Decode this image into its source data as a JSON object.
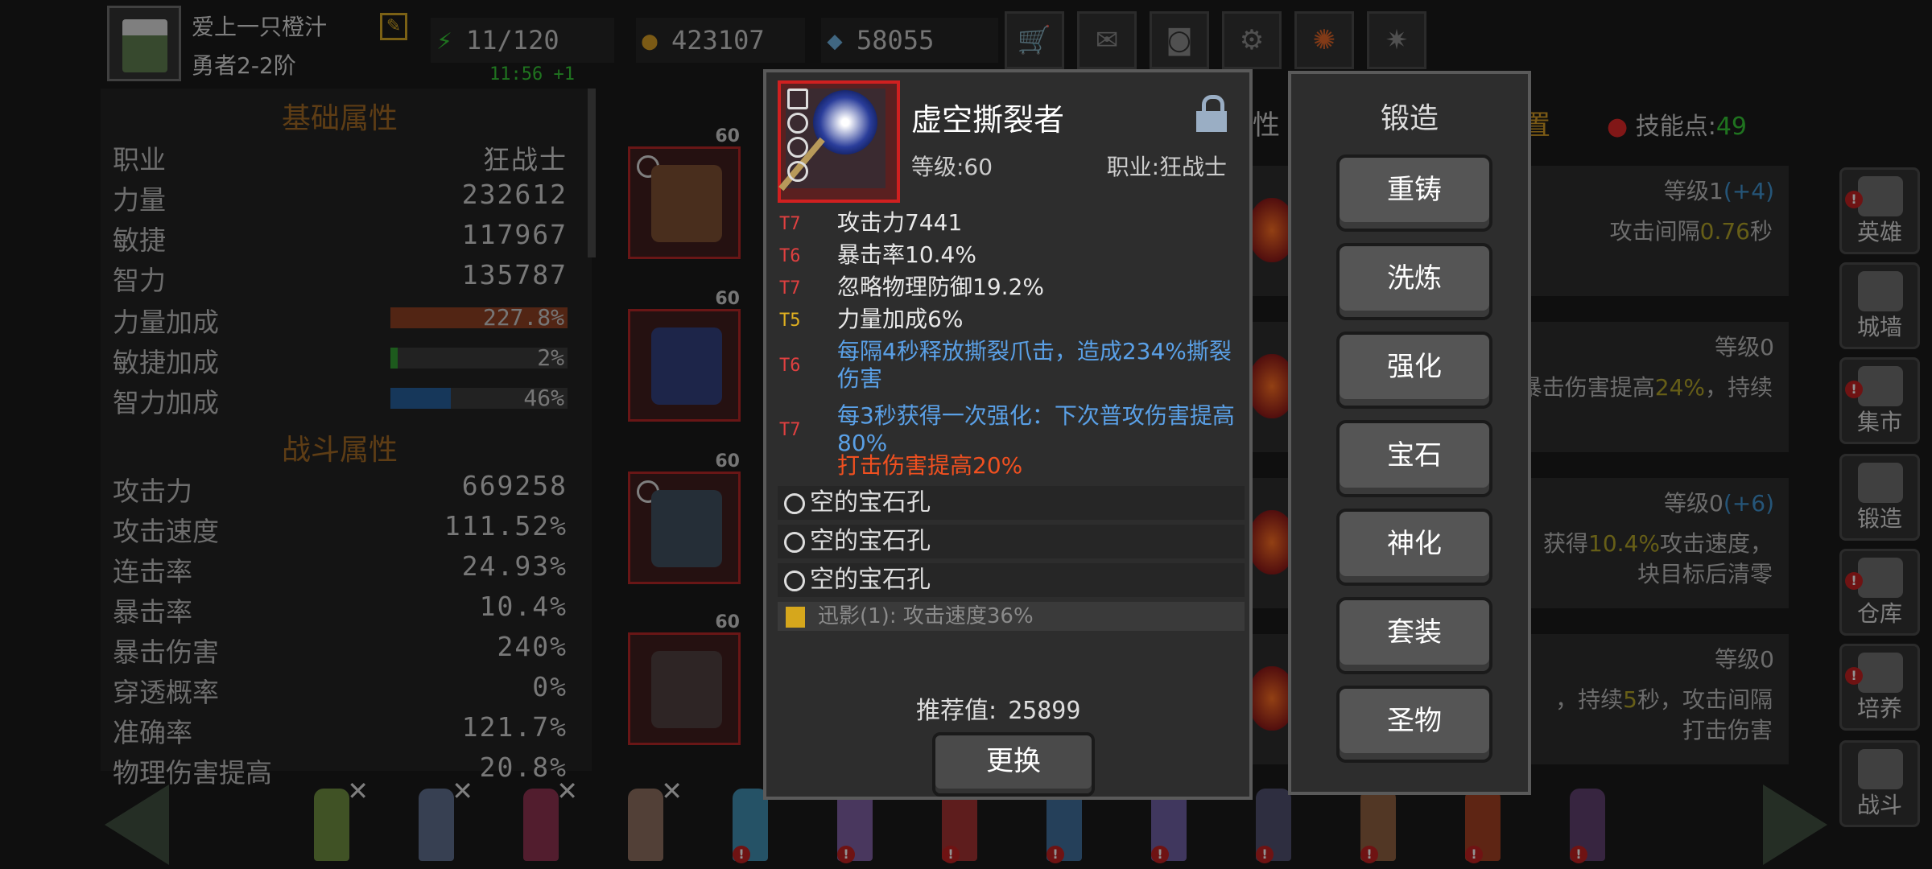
{
  "player": {
    "name": "爱上一只橙汁",
    "rank": "勇者2-2阶"
  },
  "resources": {
    "stamina": "11/120",
    "timer": "11:56 +1",
    "gold": "423107",
    "gems": "58055"
  },
  "top_icons": [
    "cart-icon",
    "mail-icon",
    "gamepad-icon",
    "gear-icon",
    "aperture-icon",
    "sparkle-icon"
  ],
  "left_panel": {
    "basic_title": "基础属性",
    "basic": [
      {
        "label": "职业",
        "value": "狂战士"
      },
      {
        "label": "力量",
        "value": "232612"
      },
      {
        "label": "敏捷",
        "value": "117967"
      },
      {
        "label": "智力",
        "value": "135787"
      }
    ],
    "bonuses": [
      {
        "label": "力量加成",
        "value": "227.8%",
        "fill": 1.0,
        "color": "#8a3a1a"
      },
      {
        "label": "敏捷加成",
        "value": "2%",
        "fill": 0.04,
        "color": "#2a9a2a"
      },
      {
        "label": "智力加成",
        "value": "46%",
        "fill": 0.34,
        "color": "#1e5a9a"
      }
    ],
    "combat_title": "战斗属性",
    "combat": [
      {
        "label": "攻击力",
        "value": "669258"
      },
      {
        "label": "攻击速度",
        "value": "111.52%"
      },
      {
        "label": "连击率",
        "value": "24.93%"
      },
      {
        "label": "暴击率",
        "value": "10.4%"
      },
      {
        "label": "暴击伤害",
        "value": "240%"
      },
      {
        "label": "穿透概率",
        "value": "0%"
      },
      {
        "label": "准确率",
        "value": "121.7%"
      },
      {
        "label": "物理伤害提高",
        "value": "20.8%"
      }
    ]
  },
  "equip_slots": [
    {
      "level": "60"
    },
    {
      "level": "60"
    },
    {
      "level": "60"
    },
    {
      "level": "60"
    }
  ],
  "skills_bg": {
    "tab_partial": "性",
    "reset_partial": "置",
    "skill_points_label": "技能点:",
    "skill_points": "49",
    "cards": [
      {
        "level": "等级1",
        "bonus": "(+4)",
        "desc_pre": "攻击间隔",
        "desc_hl": "0.76",
        "desc_post": "秒"
      },
      {
        "level": "等级0",
        "bonus": "",
        "desc_pre": "暴击伤害提高",
        "desc_hl": "24%",
        "desc_post": "，持续"
      },
      {
        "level": "等级0",
        "bonus": "(+6)",
        "desc_pre": "获得",
        "desc_hl": "10.4%",
        "desc_post": "攻击速度，",
        "desc2": "块目标后清零"
      },
      {
        "level": "等级0",
        "bonus": "",
        "desc_pre": "，持续",
        "desc_hl": "5",
        "desc_post": "秒，攻击间隔",
        "desc2": "打击伤害"
      }
    ]
  },
  "item": {
    "name": "虚空撕裂者",
    "level": "等级:60",
    "class": "职业:狂战士",
    "attrs": [
      {
        "tier": "T7",
        "text": "攻击力7441",
        "tier_color": "#e04040",
        "text_color": "#e8e8e8"
      },
      {
        "tier": "T6",
        "text": "暴击率10.4%",
        "tier_color": "#e04040",
        "text_color": "#e8e8e8"
      },
      {
        "tier": "T7",
        "text": "忽略物理防御19.2%",
        "tier_color": "#e04040",
        "text_color": "#e8e8e8"
      },
      {
        "tier": "T5",
        "text": "力量加成6%",
        "tier_color": "#e0b020",
        "text_color": "#e8e8e8"
      },
      {
        "tier": "T6",
        "text": "每隔4秒释放撕裂爪击，造成234%撕裂伤害",
        "tier_color": "#e04040",
        "text_color": "#5aa0e6"
      },
      {
        "tier": "T7",
        "text": "每3秒获得一次强化：下次普攻伤害提高80%",
        "tier_color": "#e04040",
        "text_color": "#5aa0e6"
      },
      {
        "tier": "",
        "text": "打击伤害提高20%",
        "tier_color": "#e04040",
        "text_color": "#f05020"
      }
    ],
    "gem_slots": [
      "空的宝石孔",
      "空的宝石孔",
      "空的宝石孔"
    ],
    "set_bonus": "迅影(1): 攻击速度36%",
    "recommend_label": "推荐值:",
    "recommend_value": "25899",
    "swap_label": "更换"
  },
  "forge": {
    "title": "锻造",
    "buttons": [
      "重铸",
      "洗炼",
      "强化",
      "宝石",
      "神化",
      "套装",
      "圣物"
    ]
  },
  "sidebar": [
    {
      "label": "英雄",
      "warn": true
    },
    {
      "label": "城墙",
      "warn": false
    },
    {
      "label": "集市",
      "warn": true
    },
    {
      "label": "锻造",
      "warn": false
    },
    {
      "label": "仓库",
      "warn": true
    },
    {
      "label": "培养",
      "warn": true
    },
    {
      "label": "战斗",
      "warn": false
    }
  ],
  "heroes": [
    {
      "color": "#6a8a3a",
      "mark": "x"
    },
    {
      "color": "#5a6a8a",
      "mark": "x"
    },
    {
      "color": "#8a2a4a",
      "mark": "x"
    },
    {
      "color": "#8a6a5a",
      "mark": "x"
    },
    {
      "color": "#3a8ab0",
      "mark": "warn"
    },
    {
      "color": "#7a5aa0",
      "mark": "warn"
    },
    {
      "color": "#a02a2a",
      "mark": "warn"
    },
    {
      "color": "#3a6a9a",
      "mark": "warn"
    },
    {
      "color": "#6a5aa0",
      "mark": "warn"
    },
    {
      "color": "#4a4a6a",
      "mark": "warn"
    },
    {
      "color": "#8a5a3a",
      "mark": "warn"
    },
    {
      "color": "#a03a1a",
      "mark": "warn"
    },
    {
      "color": "#5a3a6a",
      "mark": "warn"
    }
  ]
}
